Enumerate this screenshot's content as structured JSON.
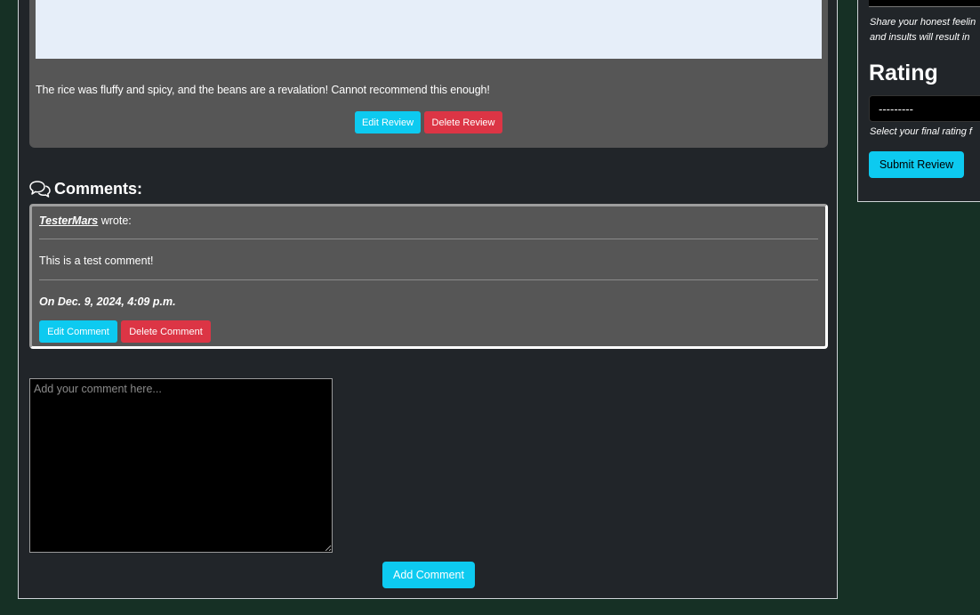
{
  "review": {
    "text": "The rice was fluffy and spicy, and the beans are a revalation! Cannot recommend this enough!",
    "edit_label": "Edit Review",
    "delete_label": "Delete Review"
  },
  "comments": {
    "heading": "Comments:",
    "items": [
      {
        "author": "TesterMars",
        "wrote": "wrote:",
        "body": "This is a test comment!",
        "date": "On Dec. 9, 2024, 4:09 p.m.",
        "edit_label": "Edit Comment",
        "delete_label": "Delete Comment"
      }
    ],
    "textarea_placeholder": "Add your comment here...",
    "add_label": "Add Comment"
  },
  "sidebar": {
    "help_text_line1": "Share your honest feelin",
    "help_text_line2": "and insults will result in",
    "rating_heading": "Rating",
    "rating_selected": "---------",
    "rating_help": "Select your final rating f",
    "submit_label": "Submit Review"
  },
  "colors": {
    "background": "#163025",
    "panel": "#212529",
    "card": "#565656",
    "info": "#0dcaf0",
    "danger": "#dc3545"
  }
}
